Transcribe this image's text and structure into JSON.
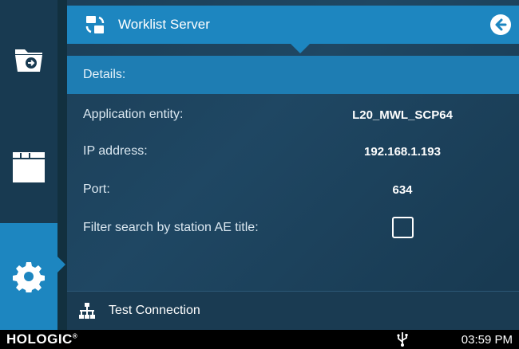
{
  "header": {
    "title": "Worklist Server",
    "icon": "worklist-sync-icon",
    "back_icon": "arrow-left-icon"
  },
  "nav": [
    {
      "name": "folder-arrow-icon"
    },
    {
      "name": "window-icon"
    },
    {
      "name": "gear-icon",
      "selected": true
    }
  ],
  "details": {
    "title": "Details:",
    "rows": [
      {
        "label": "Application entity:",
        "value": "L20_MWL_SCP64"
      },
      {
        "label": "IP address:",
        "value": "192.168.1.193"
      },
      {
        "label": "Port:",
        "value": "634"
      },
      {
        "label": "Filter search by station AE title:",
        "checked": false
      }
    ]
  },
  "actions": {
    "test_label": "Test Connection",
    "test_icon": "network-icon"
  },
  "status": {
    "logo": "HOLOGIC",
    "logo_mark": "®",
    "usb_icon": "usb-icon",
    "time": "03:59 PM"
  },
  "colors": {
    "accent": "#1d86c0",
    "panel": "#1f4763",
    "rail": "#183a51"
  }
}
